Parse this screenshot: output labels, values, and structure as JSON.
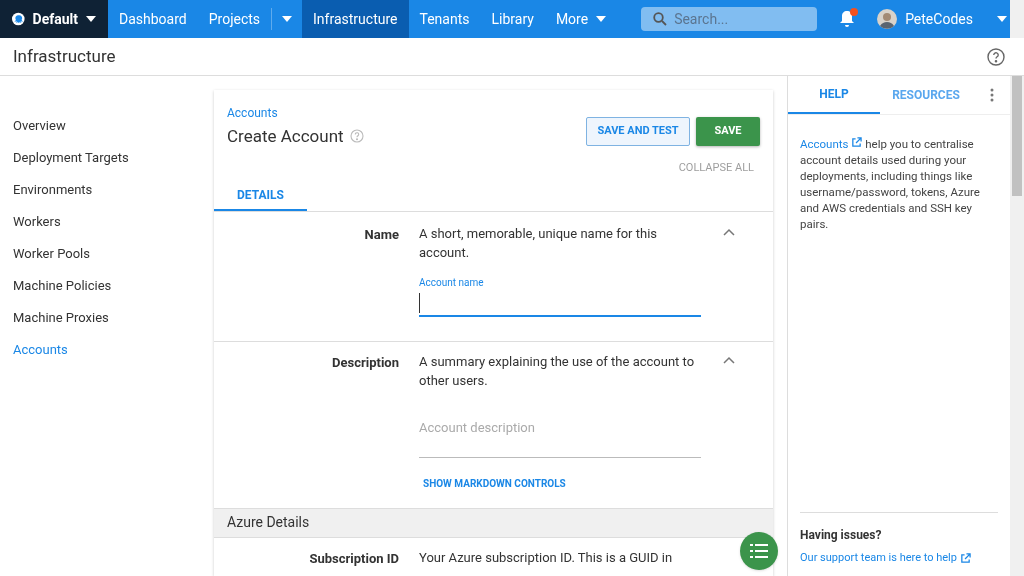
{
  "nav": {
    "space": "Default",
    "items": [
      {
        "label": "Dashboard",
        "selected": false,
        "kind": "link"
      },
      {
        "label": "Projects",
        "selected": false,
        "kind": "split"
      },
      {
        "label": "Infrastructure",
        "selected": true,
        "kind": "link"
      },
      {
        "label": "Tenants",
        "selected": false,
        "kind": "link"
      },
      {
        "label": "Library",
        "selected": false,
        "kind": "link"
      },
      {
        "label": "More",
        "selected": false,
        "kind": "menu"
      }
    ],
    "search": {
      "placeholder": "Search..."
    },
    "notifications": {
      "unread": true
    },
    "user": "PeteCodes"
  },
  "page_title": "Infrastructure",
  "sidebar": {
    "items": [
      {
        "label": "Overview",
        "selected": false
      },
      {
        "label": "Deployment Targets",
        "selected": false
      },
      {
        "label": "Environments",
        "selected": false
      },
      {
        "label": "Workers",
        "selected": false
      },
      {
        "label": "Worker Pools",
        "selected": false
      },
      {
        "label": "Machine Policies",
        "selected": false
      },
      {
        "label": "Machine Proxies",
        "selected": false
      },
      {
        "label": "Accounts",
        "selected": true
      }
    ]
  },
  "card": {
    "breadcrumb": "Accounts",
    "title": "Create Account",
    "buttons": [
      {
        "label": "SAVE AND TEST",
        "kind": "secondary"
      },
      {
        "label": "SAVE",
        "kind": "primary"
      }
    ],
    "collapse_all": "COLLAPSE ALL",
    "tabs": [
      {
        "label": "DETAILS",
        "selected": true
      }
    ],
    "sections": [
      {
        "kind": "field",
        "label": "Name",
        "help": "A short, memorable, unique name for this account.",
        "expanded": true,
        "field": {
          "kind": "text",
          "label": "Account name",
          "focused": true
        }
      },
      {
        "kind": "field",
        "label": "Description",
        "help": "A summary explaining the use of the account to other users.",
        "expanded": true,
        "field": {
          "kind": "textarea",
          "placeholder": "Account description",
          "link": "SHOW MARKDOWN CONTROLS"
        }
      },
      {
        "kind": "heading",
        "label": "Azure Details"
      },
      {
        "kind": "field",
        "label": "Subscription ID",
        "help": "Your Azure subscription ID. This is a GUID in"
      }
    ]
  },
  "help_panel": {
    "tabs": [
      {
        "label": "HELP",
        "selected": true
      },
      {
        "label": "RESOURCES",
        "selected": false
      }
    ],
    "link": "Accounts",
    "text": " help you to centralise account details used during your deployments, including things like username/password, tokens, Azure and AWS credentials and SSH key pairs.",
    "footer_title": "Having issues?",
    "footer_link": "Our support team is here to help"
  }
}
